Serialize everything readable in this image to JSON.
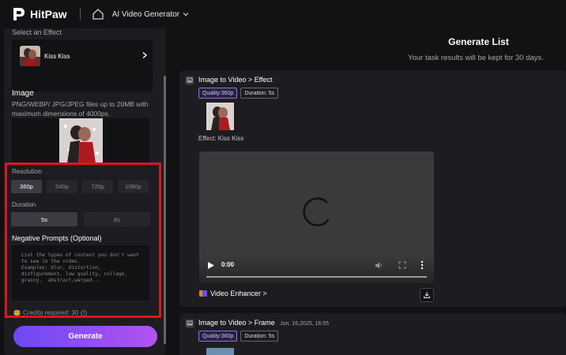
{
  "app": {
    "brand": "HitPaw",
    "product": "AI Video Generator"
  },
  "left_panel": {
    "effect_label": "Select an Effect",
    "effect_name": "Kiss Kiss",
    "image_label": "Image",
    "image_hint": "PNG/WEBP/ JPG/JPEG files up to 20MB with maximum dimensions of 4000px.",
    "resolution_label": "Resolution",
    "resolutions": [
      "360p",
      "540p",
      "720p",
      "1080p"
    ],
    "selected_resolution": "360p",
    "duration_label": "Duration",
    "durations": [
      "5s",
      "8s"
    ],
    "selected_duration": "5s",
    "negative_label": "Negative Prompts (Optional)",
    "negative_placeholder": "List the types of content you don't want to see in the video.\nExamples: blur, distortion, disfigurement, low quality, collage, grainy,  abstract,warped...",
    "credits": "Credits required: 30",
    "generate_label": "Generate"
  },
  "generate_list": {
    "title": "Generate List",
    "subtitle": "Your task results will be kept for 30 days.",
    "tasks": [
      {
        "title": "Image to Video > Effect",
        "date": "",
        "quality": "Quality:360p",
        "duration": "Duration: 5s",
        "effect": "Effect: Kiss Kiss",
        "player_time": "0:00",
        "enhancer": "Video Enhancer >"
      },
      {
        "title": "Image to Video > Frame",
        "date": "Jun, 16,2025, 16:55",
        "quality": "Quality:360p",
        "duration": "Duration: 5s"
      }
    ]
  },
  "colors": {
    "accent": "#e0141b",
    "generate_start": "#6d49f5",
    "generate_end": "#b253f0"
  }
}
